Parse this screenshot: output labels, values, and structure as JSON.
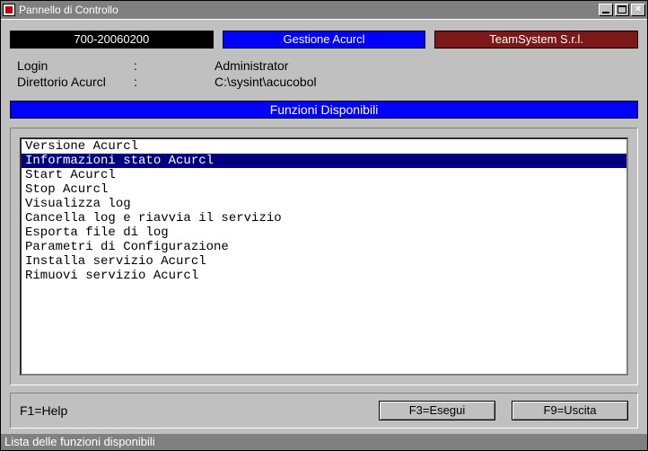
{
  "window": {
    "title": "Pannello di Controllo"
  },
  "top_bars": {
    "left": "700-20060200",
    "center": "Gestione Acurcl",
    "right": "TeamSystem S.r.l."
  },
  "info": {
    "login_label": "Login",
    "login_colon": ":",
    "login_value": "Administrator",
    "dir_label": "Direttorio Acurcl",
    "dir_colon": ":",
    "dir_value": "C:\\sysint\\acucobol"
  },
  "section_header": "Funzioni Disponibili",
  "functions": [
    "Versione Acurcl",
    "Informazioni stato Acurcl",
    "Start Acurcl",
    "Stop Acurcl",
    "Visualizza log",
    "Cancella log e riavvia il servizio",
    "Esporta file di log",
    "Parametri di Configurazione",
    "Installa servizio Acurcl",
    "Rimuovi servizio Acurcl"
  ],
  "selected_index": 1,
  "buttons": {
    "help": "F1=Help",
    "execute": "F3=Esegui",
    "exit": "F9=Uscita"
  },
  "statusbar": "Lista delle funzioni disponibili"
}
